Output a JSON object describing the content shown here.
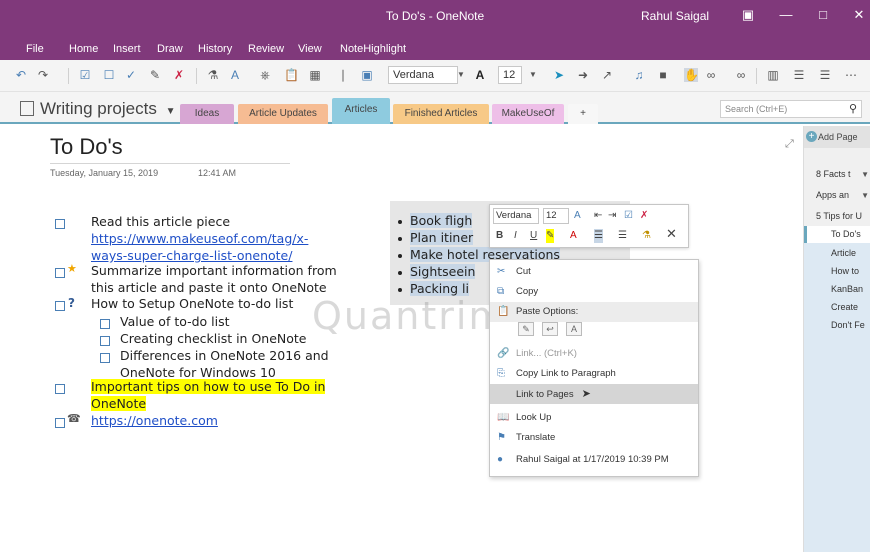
{
  "window": {
    "title": "To Do's - OneNote",
    "user": "Rahul Saigal"
  },
  "menu": [
    "File",
    "Home",
    "Insert",
    "Draw",
    "History",
    "Review",
    "View",
    "NoteHighlight"
  ],
  "toolbar": {
    "font": "Verdana",
    "size": "12"
  },
  "notebook": {
    "title": "Writing projects"
  },
  "tabs": [
    {
      "label": "Ideas",
      "color": "#d7a6d3"
    },
    {
      "label": "Article Updates",
      "color": "#f6bc93"
    },
    {
      "label": "Articles",
      "color": "#8ecbdf",
      "active": true
    },
    {
      "label": "Finished Articles",
      "color": "#f7c987"
    },
    {
      "label": "MakeUseOf",
      "color": "#eebfe8"
    },
    {
      "label": "+",
      "color": "#f7f7f7"
    }
  ],
  "search": {
    "placeholder": "Search (Ctrl+E)"
  },
  "page": {
    "title": "To Do's",
    "date": "Tuesday, January 15, 2019",
    "time": "12:41 AM",
    "todo": {
      "l1": "Read this article piece",
      "l2": "https://www.makeuseof.com/tag/x-",
      "l3": "ways-super-charge-list-onenote/",
      "l4": "Summarize important information from",
      "l5": "this article and paste it onto OneNote",
      "l6": "How to Setup OneNote to-do list",
      "l7": "Value of to-do list",
      "l8": "Creating checklist in OneNote",
      "l9": "Differences in OneNote 2016 and",
      "l10": "OneNote for Windows 10",
      "l11": "Important tips on how to use To Do in",
      "l12": "OneNote",
      "l13": "https://onenote.com"
    },
    "bullets": [
      "Book fligh",
      "Plan itiner",
      "Make hotel reservations",
      "Sightseein",
      "Packing li"
    ]
  },
  "mini_toolbar": {
    "font": "Verdana",
    "size": "12"
  },
  "context_menu": {
    "cut": "Cut",
    "copy": "Copy",
    "paste_options": "Paste Options:",
    "link": "Link...  (Ctrl+K)",
    "copy_link": "Copy Link to Paragraph",
    "link_pages": "Link to Pages",
    "lookup": "Look Up",
    "translate": "Translate",
    "author": "Rahul Saigal at 1/17/2019 10:39 PM"
  },
  "watermark": "Quantrimang",
  "page_list": {
    "add_page": "Add Page",
    "items": [
      "8 Facts t",
      "Apps an",
      "5 Tips for U",
      "To Do's",
      "Article",
      "How to",
      "KanBan",
      "Create",
      "Don't Fe"
    ]
  }
}
